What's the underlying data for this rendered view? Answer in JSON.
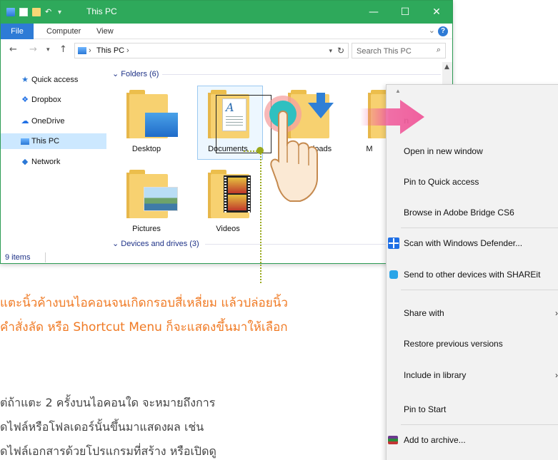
{
  "window": {
    "title": "This PC",
    "controls": {
      "minimize": "—",
      "maximize": "☐",
      "close": "✕"
    }
  },
  "ribbon": {
    "tabs": [
      "File",
      "Computer",
      "View"
    ],
    "expand": "⌄",
    "help": "?"
  },
  "address_bar": {
    "back": "←",
    "forward": "→",
    "recent": "▾",
    "up": "↑",
    "separator": "›",
    "location": "This PC",
    "dropdown": "▾",
    "refresh": "↻"
  },
  "search": {
    "placeholder": "Search This PC",
    "icon": "⌕"
  },
  "nav_pane": {
    "items": [
      {
        "label": "Quick access",
        "icon": "star-icon"
      },
      {
        "label": "Dropbox",
        "icon": "dropbox-icon"
      },
      {
        "label": "OneDrive",
        "icon": "cloud-icon"
      },
      {
        "label": "This PC",
        "icon": "computer-icon",
        "selected": true
      },
      {
        "label": "Network",
        "icon": "network-icon"
      }
    ]
  },
  "content": {
    "folders_header": "Folders (6)",
    "drives_header": "Devices and drives (3)",
    "folders": [
      {
        "label": "Desktop"
      },
      {
        "label": "Documents",
        "selected": true
      },
      {
        "label": "loads"
      },
      {
        "label": "M"
      },
      {
        "label": "Pictures"
      },
      {
        "label": "Videos"
      }
    ]
  },
  "status": {
    "items_count": "9 items"
  },
  "context_menu": {
    "items": [
      {
        "label": "n",
        "bold": true
      },
      {
        "label": "Open in new window"
      },
      {
        "label": "Pin to Quick access"
      },
      {
        "label": "Browse in Adobe Bridge CS6"
      },
      {
        "label": "Scan with Windows Defender...",
        "icon": "shield-icon"
      },
      {
        "label": "Send to other devices with SHAREit",
        "icon": "shareit-icon"
      },
      {
        "label": "Share with",
        "submenu": "›"
      },
      {
        "label": "Restore previous versions"
      },
      {
        "label": "Include in library",
        "submenu": "›"
      },
      {
        "label": "Pin to Start"
      },
      {
        "label": "Add to archive...",
        "icon": "winrar-icon"
      }
    ]
  },
  "annotations": {
    "line1": "แตะนิ้วค้างบนไอคอนจนเกิดกรอบสี่เหลี่ยม แล้วปล่อยนิ้ว",
    "line2": "คำสั่งลัด หรือ Shortcut Menu ก็จะแสดงขึ้นมาให้เลือก",
    "body1": "ต่ถ้าแตะ 2 ครั้งบนไอคอนใด จะหมายถึงการ",
    "body2": "ดไฟล์หรือโฟลเดอร์นั้นขึ้นมาแสดงผล เช่น",
    "body3": "ดไฟล์เอกสารด้วยโปรแกรมที่สร้าง หรือเปิดดู"
  },
  "colors": {
    "titlebar": "#2ea95b",
    "file_tab": "#2e7bd6",
    "selection": "#cce8ff",
    "annotation_orange": "#f07a24",
    "guide_olive": "#9aa81c",
    "pink_arrow": "#f0609e"
  }
}
